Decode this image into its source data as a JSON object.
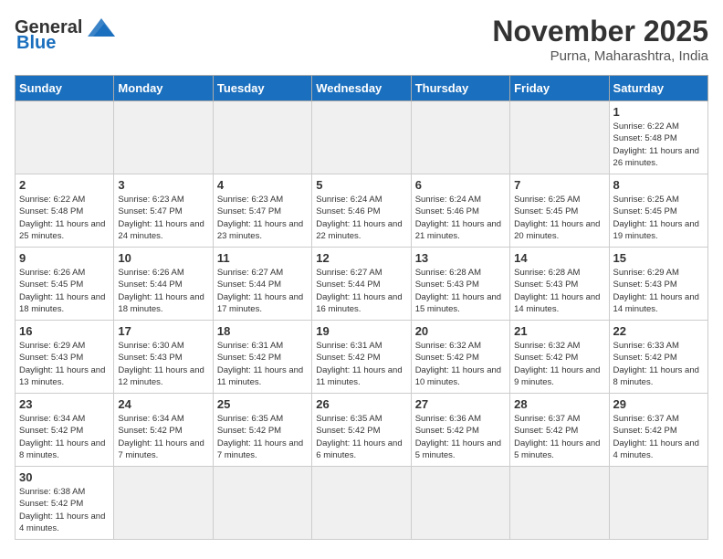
{
  "logo": {
    "general": "General",
    "blue": "Blue"
  },
  "header": {
    "month": "November 2025",
    "location": "Purna, Maharashtra, India"
  },
  "weekdays": [
    "Sunday",
    "Monday",
    "Tuesday",
    "Wednesday",
    "Thursday",
    "Friday",
    "Saturday"
  ],
  "cells": [
    {
      "day": "",
      "empty": true
    },
    {
      "day": "",
      "empty": true
    },
    {
      "day": "",
      "empty": true
    },
    {
      "day": "",
      "empty": true
    },
    {
      "day": "",
      "empty": true
    },
    {
      "day": "",
      "empty": true
    },
    {
      "day": "1",
      "sunrise": "6:22 AM",
      "sunset": "5:48 PM",
      "daylight": "11 hours and 26 minutes."
    },
    {
      "day": "2",
      "sunrise": "6:22 AM",
      "sunset": "5:48 PM",
      "daylight": "11 hours and 25 minutes."
    },
    {
      "day": "3",
      "sunrise": "6:23 AM",
      "sunset": "5:47 PM",
      "daylight": "11 hours and 24 minutes."
    },
    {
      "day": "4",
      "sunrise": "6:23 AM",
      "sunset": "5:47 PM",
      "daylight": "11 hours and 23 minutes."
    },
    {
      "day": "5",
      "sunrise": "6:24 AM",
      "sunset": "5:46 PM",
      "daylight": "11 hours and 22 minutes."
    },
    {
      "day": "6",
      "sunrise": "6:24 AM",
      "sunset": "5:46 PM",
      "daylight": "11 hours and 21 minutes."
    },
    {
      "day": "7",
      "sunrise": "6:25 AM",
      "sunset": "5:45 PM",
      "daylight": "11 hours and 20 minutes."
    },
    {
      "day": "8",
      "sunrise": "6:25 AM",
      "sunset": "5:45 PM",
      "daylight": "11 hours and 19 minutes."
    },
    {
      "day": "9",
      "sunrise": "6:26 AM",
      "sunset": "5:45 PM",
      "daylight": "11 hours and 18 minutes."
    },
    {
      "day": "10",
      "sunrise": "6:26 AM",
      "sunset": "5:44 PM",
      "daylight": "11 hours and 18 minutes."
    },
    {
      "day": "11",
      "sunrise": "6:27 AM",
      "sunset": "5:44 PM",
      "daylight": "11 hours and 17 minutes."
    },
    {
      "day": "12",
      "sunrise": "6:27 AM",
      "sunset": "5:44 PM",
      "daylight": "11 hours and 16 minutes."
    },
    {
      "day": "13",
      "sunrise": "6:28 AM",
      "sunset": "5:43 PM",
      "daylight": "11 hours and 15 minutes."
    },
    {
      "day": "14",
      "sunrise": "6:28 AM",
      "sunset": "5:43 PM",
      "daylight": "11 hours and 14 minutes."
    },
    {
      "day": "15",
      "sunrise": "6:29 AM",
      "sunset": "5:43 PM",
      "daylight": "11 hours and 14 minutes."
    },
    {
      "day": "16",
      "sunrise": "6:29 AM",
      "sunset": "5:43 PM",
      "daylight": "11 hours and 13 minutes."
    },
    {
      "day": "17",
      "sunrise": "6:30 AM",
      "sunset": "5:43 PM",
      "daylight": "11 hours and 12 minutes."
    },
    {
      "day": "18",
      "sunrise": "6:31 AM",
      "sunset": "5:42 PM",
      "daylight": "11 hours and 11 minutes."
    },
    {
      "day": "19",
      "sunrise": "6:31 AM",
      "sunset": "5:42 PM",
      "daylight": "11 hours and 11 minutes."
    },
    {
      "day": "20",
      "sunrise": "6:32 AM",
      "sunset": "5:42 PM",
      "daylight": "11 hours and 10 minutes."
    },
    {
      "day": "21",
      "sunrise": "6:32 AM",
      "sunset": "5:42 PM",
      "daylight": "11 hours and 9 minutes."
    },
    {
      "day": "22",
      "sunrise": "6:33 AM",
      "sunset": "5:42 PM",
      "daylight": "11 hours and 8 minutes."
    },
    {
      "day": "23",
      "sunrise": "6:34 AM",
      "sunset": "5:42 PM",
      "daylight": "11 hours and 8 minutes."
    },
    {
      "day": "24",
      "sunrise": "6:34 AM",
      "sunset": "5:42 PM",
      "daylight": "11 hours and 7 minutes."
    },
    {
      "day": "25",
      "sunrise": "6:35 AM",
      "sunset": "5:42 PM",
      "daylight": "11 hours and 7 minutes."
    },
    {
      "day": "26",
      "sunrise": "6:35 AM",
      "sunset": "5:42 PM",
      "daylight": "11 hours and 6 minutes."
    },
    {
      "day": "27",
      "sunrise": "6:36 AM",
      "sunset": "5:42 PM",
      "daylight": "11 hours and 5 minutes."
    },
    {
      "day": "28",
      "sunrise": "6:37 AM",
      "sunset": "5:42 PM",
      "daylight": "11 hours and 5 minutes."
    },
    {
      "day": "29",
      "sunrise": "6:37 AM",
      "sunset": "5:42 PM",
      "daylight": "11 hours and 4 minutes."
    },
    {
      "day": "30",
      "sunrise": "6:38 AM",
      "sunset": "5:42 PM",
      "daylight": "11 hours and 4 minutes."
    },
    {
      "day": "",
      "empty": true
    },
    {
      "day": "",
      "empty": true
    },
    {
      "day": "",
      "empty": true
    },
    {
      "day": "",
      "empty": true
    },
    {
      "day": "",
      "empty": true
    },
    {
      "day": "",
      "empty": true
    }
  ]
}
